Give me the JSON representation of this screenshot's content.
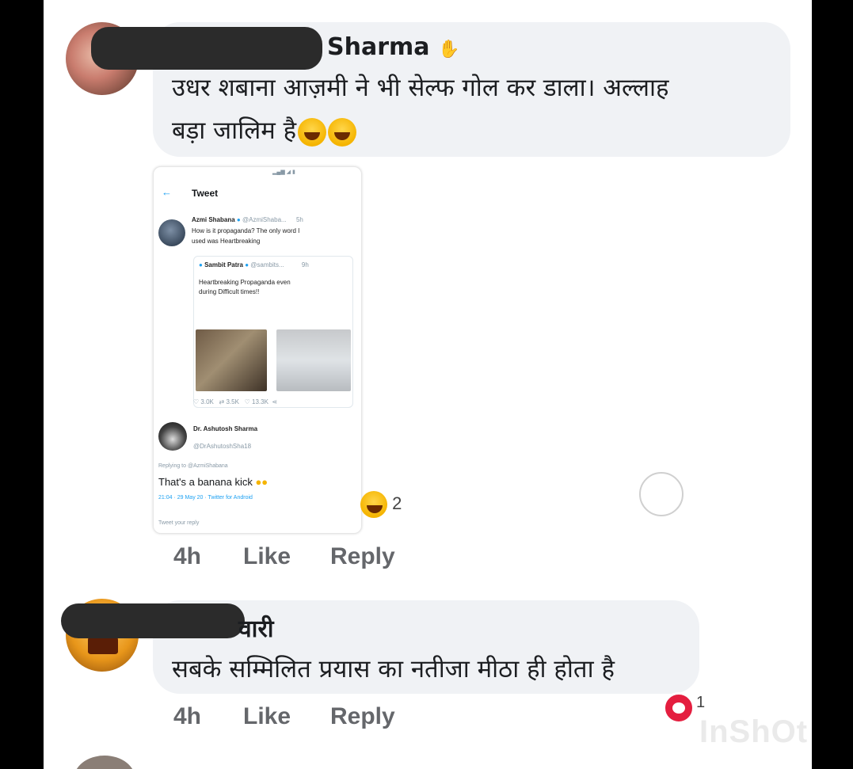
{
  "comments": [
    {
      "author_visible": "Sharma",
      "text_line1": "उधर शबाना आज़मी ने भी सेल्फ गोल कर डाला। अल्लाह",
      "text_line2": "बड़ा जालिम है",
      "time": "4h",
      "like": "Like",
      "reply": "Reply",
      "reaction_count": "2"
    },
    {
      "author_visible": "वारी",
      "text": "सबके सम्मिलित प्रयास का नतीजा मीठा ही होता है",
      "time": "4h",
      "like": "Like",
      "reply": "Reply",
      "reaction_count": "1"
    }
  ],
  "tweet": {
    "header": "Tweet",
    "author": "Azmi Shabana",
    "handle": "@AzmiShaba...",
    "age": "5h",
    "text1": "How is it propaganda? The only word I",
    "text2": "used was Heartbreaking",
    "quoted_author": "Sambit Patra",
    "quoted_handle": "@sambits...",
    "quoted_age": "9h",
    "quoted_text1": "Heartbreaking Propaganda even",
    "quoted_text2": "during Difficult times!!",
    "stats": [
      "3.0K",
      "3.5K",
      "13.3K"
    ],
    "reply_author": "Dr. Ashutosh Sharma",
    "reply_handle": "@DrAshutoshSha18",
    "replying_to": "Replying to @AzmiShabana",
    "reply_text": "That's a banana kick",
    "reply_meta": "21:04 · 29 May 20 · Twitter for Android",
    "reply_box": "Tweet your reply"
  },
  "watermark": "InShOt",
  "colors": {
    "bubble": "#f0f2f5",
    "action_text": "#65676b",
    "twitter_blue": "#1da1f2",
    "reaction_red": "#e41e3f"
  }
}
